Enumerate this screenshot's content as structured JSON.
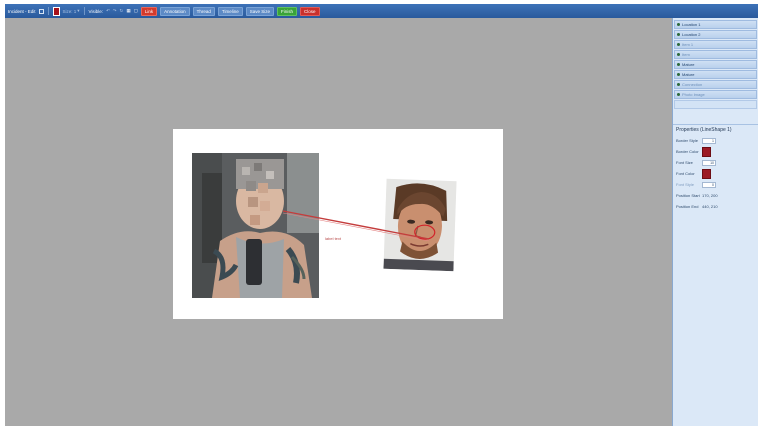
{
  "toolbar": {
    "title": "Incident - Edit",
    "size_label": "Size: 1",
    "opacity_label": "Visible:",
    "menu_items": [
      "Link",
      "Annotation",
      "Thread",
      "Timeline",
      "Save Size",
      "Finish",
      "Close"
    ]
  },
  "canvas": {
    "connector_label": "label text"
  },
  "sidebar": {
    "layers": [
      {
        "label": "Location 1"
      },
      {
        "label": "Location 2"
      },
      {
        "label": "Item 1"
      },
      {
        "label": "Item"
      },
      {
        "label": "Mature"
      },
      {
        "label": "Mature"
      },
      {
        "label": "Connection"
      },
      {
        "label": "Photo Image"
      }
    ],
    "properties": {
      "title": "Properties (LineShape 1)",
      "rows": [
        {
          "label": "Border Style",
          "value": "1"
        },
        {
          "label": "Border Color",
          "value": ""
        },
        {
          "label": "Font Size",
          "value": "10"
        },
        {
          "label": "Font Color",
          "value": ""
        },
        {
          "label": "Font Style",
          "value": "0"
        },
        {
          "label": "Position Start",
          "value": "170, 200"
        },
        {
          "label": "Position End",
          "value": "440, 210"
        }
      ]
    }
  },
  "colors": {
    "toolbar_bg": "#2f63a8",
    "canvas_bg": "#a9a9a9",
    "connector": "#c43c3c",
    "accent_red": "#a5121c",
    "sidebar_bg": "#dbe8f7"
  }
}
